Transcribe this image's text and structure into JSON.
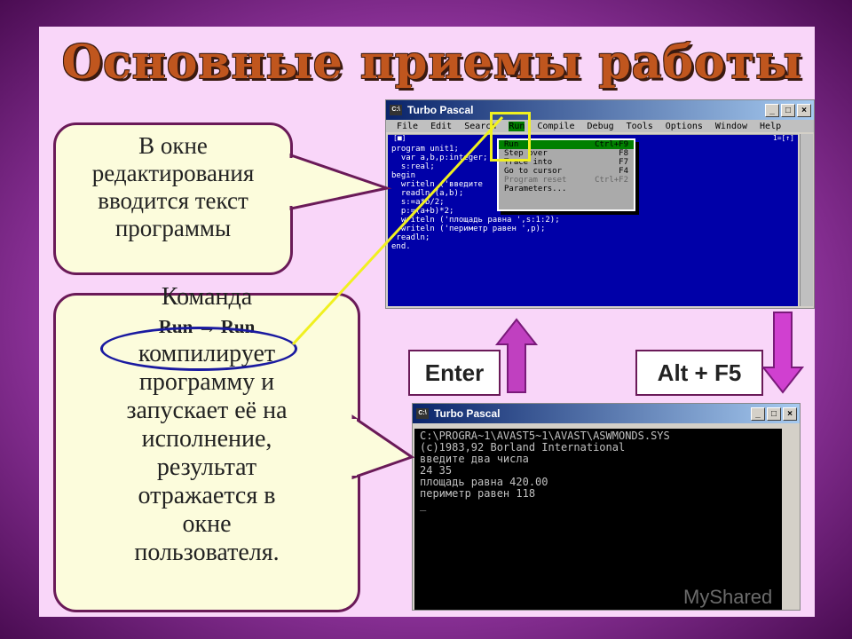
{
  "slide": {
    "title": "Основные приемы работы",
    "callout1_lines": [
      "В окне",
      "редактирования",
      "вводится текст",
      "программы"
    ],
    "callout2_lines": [
      "Команда",
      "Run → Run",
      "компилирует",
      "программу и",
      "запускает её на",
      "исполнение,",
      "результат",
      "отражается в",
      "окне",
      "пользователя."
    ],
    "key_enter": "Enter",
    "key_alt": "Alt + F5",
    "watermark": "MyShared"
  },
  "editor_window": {
    "title": "Turbo Pascal",
    "icon": "window-icon",
    "buttons": [
      "_",
      "□",
      "×"
    ],
    "menu": [
      "File",
      "Edit",
      "Search",
      "Run",
      "Compile",
      "Debug",
      "Tools",
      "Options",
      "Window",
      "Help"
    ],
    "editor_header_left": "[■]",
    "editor_header_right": "1=[↑]",
    "code": "program unit1;\n  var a,b,p:integer;\n  s:real;\nbegin\n  writeln ('введите\n  readln (a,b);\n  s:=a*b/2;\n  p:=(a+b)*2;\n  writeln ('площадь равна ',s:1:2);\n  writeln ('периметр равен ',p);\n readln;\nend.",
    "run_menu": [
      {
        "label": "Run",
        "shortcut": "Ctrl+F9",
        "state": "selected"
      },
      {
        "label": "Step over",
        "shortcut": "F8",
        "state": "normal"
      },
      {
        "label": "Trace into",
        "shortcut": "F7",
        "state": "normal"
      },
      {
        "label": "Go to cursor",
        "shortcut": "F4",
        "state": "normal"
      },
      {
        "label": "Program reset",
        "shortcut": "Ctrl+F2",
        "state": "disabled"
      },
      {
        "label": "Parameters...",
        "shortcut": "",
        "state": "normal"
      }
    ]
  },
  "console_window": {
    "title": "Turbo Pascal",
    "buttons": [
      "_",
      "□",
      "×"
    ],
    "output": "C:\\PROGRA~1\\AVAST5~1\\AVAST\\ASWMONDS.SYS\n(c)1983,92 Borland International\nвведите два числа\n24 35\nплощадь равна 420.00\nпериметр равен 118\n_"
  },
  "colors": {
    "arrow_up": "#c040c0",
    "arrow_down": "#d040d0",
    "highlight_yellow": "#f0f020",
    "ellipse_blue": "#1a1aa0",
    "title_orange": "#c0561e"
  }
}
